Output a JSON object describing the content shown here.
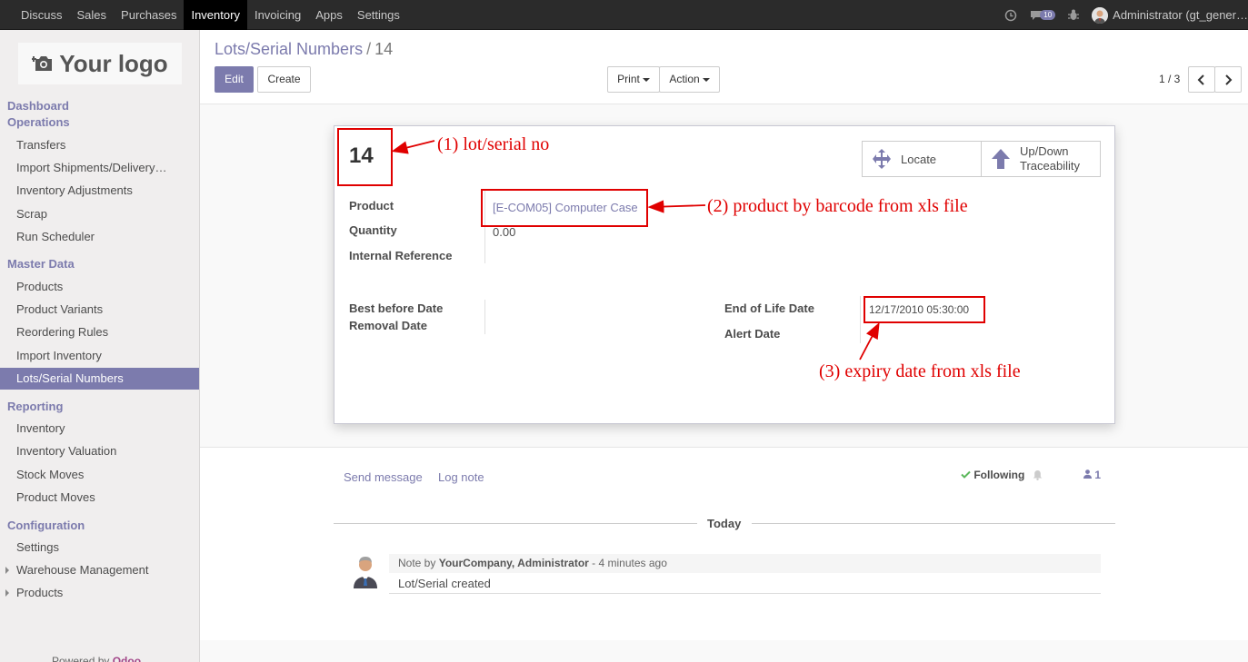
{
  "topbar": {
    "menu": [
      "Discuss",
      "Sales",
      "Purchases",
      "Inventory",
      "Invoicing",
      "Apps",
      "Settings"
    ],
    "active": "Inventory",
    "message_count": "10",
    "user": "Administrator (gt_gener…"
  },
  "sidebar": {
    "logo_text": "Your logo",
    "sections": {
      "dashboard": "Dashboard",
      "operations": "Operations",
      "master_data": "Master Data",
      "reporting": "Reporting",
      "configuration": "Configuration"
    },
    "operations_items": [
      "Transfers",
      "Import Shipments/Delivery…",
      "Inventory Adjustments",
      "Scrap",
      "Run Scheduler"
    ],
    "master_items": [
      "Products",
      "Product Variants",
      "Reordering Rules",
      "Import Inventory",
      "Lots/Serial Numbers"
    ],
    "reporting_items": [
      "Inventory",
      "Inventory Valuation",
      "Stock Moves",
      "Product Moves"
    ],
    "config_items": [
      "Settings",
      "Warehouse Management",
      "Products"
    ],
    "powered_by": "Powered by",
    "powered_brand": "Odoo"
  },
  "control": {
    "breadcrumb_parent": "Lots/Serial Numbers",
    "breadcrumb_sep": "/",
    "breadcrumb_current": "14",
    "edit": "Edit",
    "create": "Create",
    "print": "Print",
    "action": "Action",
    "pager": "1 / 3"
  },
  "record": {
    "name": "14",
    "locate": "Locate",
    "updown_line1": "Up/Down",
    "updown_line2": "Traceability",
    "product_label": "Product",
    "product_value": "[E-COM05] Computer Case",
    "quantity_label": "Quantity",
    "quantity_value": "0.00",
    "internal_ref_label": "Internal Reference",
    "best_before_label": "Best before Date",
    "removal_label": "Removal Date",
    "end_of_life_label": "End of Life Date",
    "end_of_life_value": "12/17/2010 05:30:00",
    "alert_label": "Alert Date"
  },
  "annotations": {
    "a1": "(1) lot/serial no",
    "a2": "(2) product by barcode from xls file",
    "a3": "(3) expiry date from xls file"
  },
  "chatter": {
    "send_message": "Send message",
    "log_note": "Log note",
    "following": "Following",
    "followers": "1",
    "today": "Today",
    "note_prefix": "Note by",
    "note_author": "YourCompany, Administrator",
    "note_time": "- 4 minutes ago",
    "note_body": "Lot/Serial created"
  },
  "colors": {
    "accent": "#7c7bad",
    "annotation": "#e00000",
    "navbar": "#2b2b2b"
  }
}
